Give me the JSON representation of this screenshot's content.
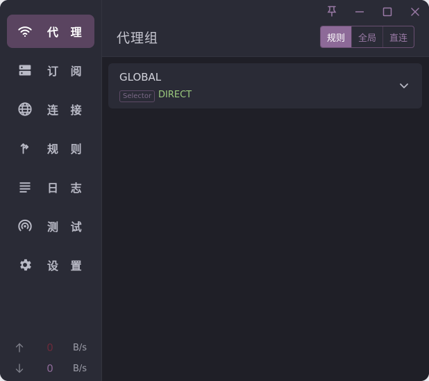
{
  "colors": {
    "accent": "#8d6a98",
    "active_nav_bg": "#5a4460",
    "sidebar_bg": "#2a2b36",
    "content_bg": "#1f1f27",
    "direct_text": "#9ccb7e"
  },
  "sidebar": {
    "items": [
      {
        "label": "代 理",
        "icon": "wifi-icon",
        "active": true
      },
      {
        "label": "订 阅",
        "icon": "server-icon",
        "active": false
      },
      {
        "label": "连 接",
        "icon": "globe-icon",
        "active": false
      },
      {
        "label": "规 则",
        "icon": "fork-arrow-icon",
        "active": false
      },
      {
        "label": "日 志",
        "icon": "lines-icon",
        "active": false
      },
      {
        "label": "测 试",
        "icon": "radar-icon",
        "active": false
      },
      {
        "label": "设 置",
        "icon": "gear-icon",
        "active": false
      }
    ],
    "traffic": {
      "upload": {
        "value": "0",
        "unit": "B/s"
      },
      "download": {
        "value": "0",
        "unit": "B/s"
      }
    }
  },
  "header": {
    "title": "代理组",
    "modes": [
      {
        "label": "规则",
        "active": true
      },
      {
        "label": "全局",
        "active": false
      },
      {
        "label": "直连",
        "active": false
      }
    ]
  },
  "groups": [
    {
      "name": "GLOBAL",
      "type": "Selector",
      "now": "DIRECT"
    }
  ]
}
